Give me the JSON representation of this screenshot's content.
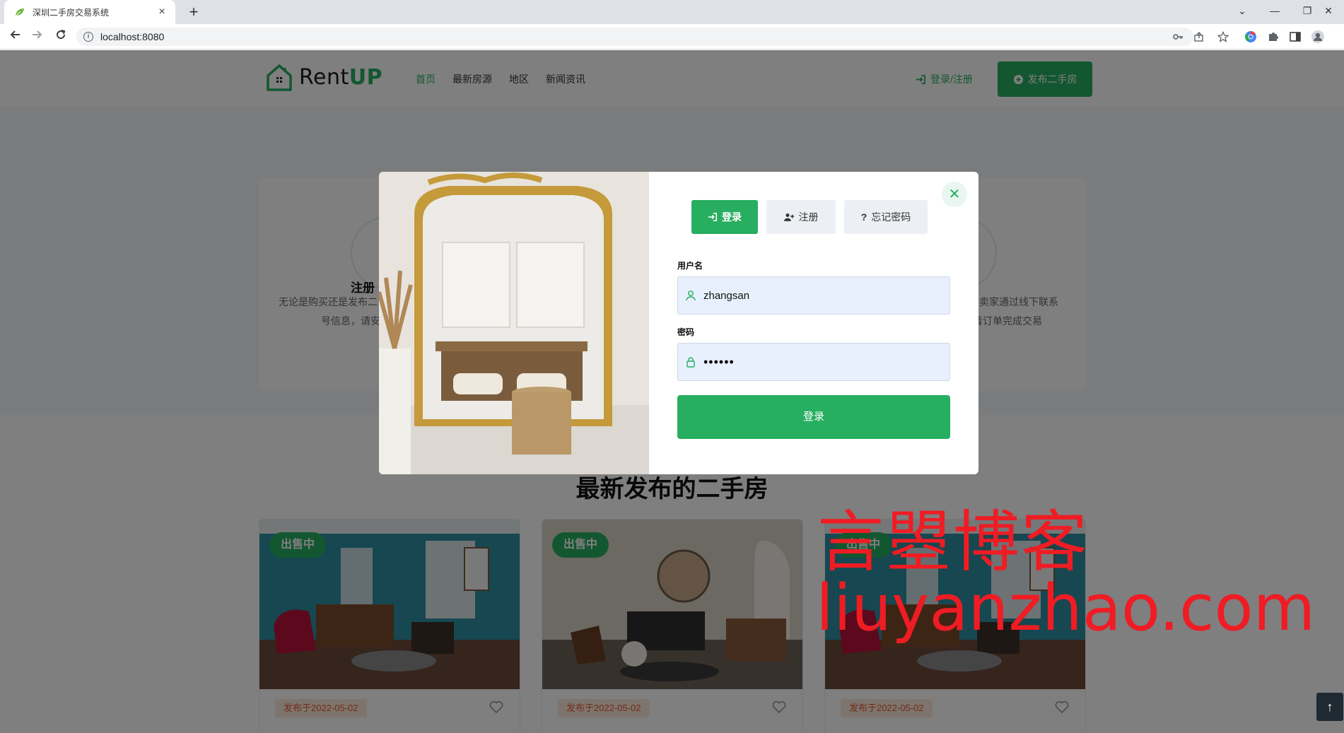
{
  "browser": {
    "tab_title": "深圳二手房交易系统",
    "tab_close": "×",
    "new_tab": "+",
    "url": "localhost:8080",
    "minimize": "—",
    "restore": "❐",
    "close": "✕",
    "tab_dropdown": "⌄"
  },
  "site": {
    "logo_main": "Rent",
    "logo_accent": "UP",
    "nav": [
      "首页",
      "最新房源",
      "地区",
      "新闻资讯"
    ],
    "login_link": "登录/注册",
    "publish_button": "发布二手房"
  },
  "features": {
    "left_title": "注册",
    "left_desc_line1": "无论是购买还是发布二",
    "left_desc_line2": "号信息，请安",
    "right_title": "!",
    "right_desc_line1": "与卖家通过线下联系",
    "right_desc_line2": "着订单完成交易"
  },
  "latest": {
    "title": "最新发布的二手房",
    "cards": [
      {
        "badge": "出售中",
        "date": "发布于2022-05-02"
      },
      {
        "badge": "出售中",
        "date": "发布于2022-05-02"
      },
      {
        "badge": "出售中",
        "date": "发布于2022-05-02"
      }
    ]
  },
  "watermark": {
    "cn": "言曌博客",
    "en": "liuyanzhao.com"
  },
  "modal": {
    "tabs": {
      "login": "登录",
      "register": "注册",
      "forgot": "忘记密码"
    },
    "username_label": "用户名",
    "username_value": "zhangsan",
    "password_label": "密码",
    "password_value": "••••••",
    "submit": "登录",
    "close": "✕"
  },
  "scroll_top": "↑",
  "colors": {
    "accent": "#27ae60",
    "watermark": "#ef1c24",
    "date_tag_bg": "#fde8dd",
    "date_tag_text": "#e05a2b"
  },
  "icons": [
    "leaf-favicon-icon",
    "info-icon",
    "key-icon",
    "share-icon",
    "star-icon",
    "chrome-icon",
    "puzzle-icon",
    "sidepanel-icon",
    "profile-icon",
    "house-logo-icon",
    "sign-in-icon",
    "plus-circle-icon",
    "user-plus-icon",
    "question-icon",
    "user-icon",
    "lock-icon",
    "close-icon",
    "heart-icon",
    "arrow-up-icon"
  ]
}
